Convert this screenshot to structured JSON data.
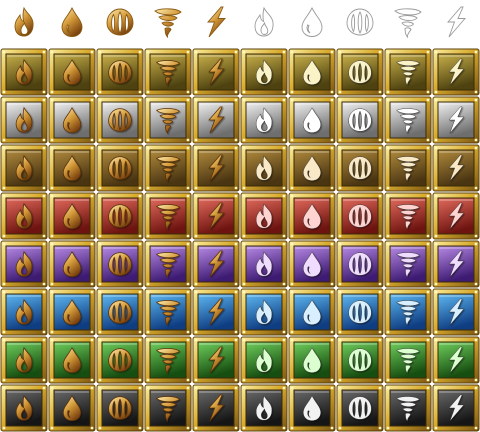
{
  "sprite_sheet": {
    "elements": [
      "fire",
      "water",
      "earth",
      "wind",
      "lightning"
    ],
    "header_styles": [
      "gold-outline",
      "white-outline"
    ],
    "tile_variants": [
      "gold-emblem",
      "white-emblem"
    ],
    "gold": {
      "frame_light": "#f7e27a",
      "frame_mid": "#d9ab2e",
      "frame_dark": "#7a5510",
      "emblem_light": "#fff0b5",
      "emblem_mid": "#d49a3a",
      "emblem_dark": "#6e3d0c"
    },
    "rows": [
      {
        "theme": "olive",
        "top": "#c9b04a",
        "bottom": "#4d4210",
        "white_tint": "#fbf3c8"
      },
      {
        "theme": "silver",
        "top": "#f2f2f2",
        "bottom": "#6e6e6e",
        "white_tint": "#ffffff"
      },
      {
        "theme": "brown",
        "top": "#b08a3c",
        "bottom": "#4a3512",
        "white_tint": "#fae9c6"
      },
      {
        "theme": "red",
        "top": "#e26a5c",
        "bottom": "#6e1410",
        "white_tint": "#ffd3cf"
      },
      {
        "theme": "purple",
        "top": "#b78ae6",
        "bottom": "#3e1b72",
        "white_tint": "#f0dcff"
      },
      {
        "theme": "blue",
        "top": "#5db8f2",
        "bottom": "#0f3d82",
        "white_tint": "#d8efff"
      },
      {
        "theme": "green",
        "top": "#6fcf5c",
        "bottom": "#164d10",
        "white_tint": "#dcffd0"
      },
      {
        "theme": "black",
        "top": "#6a6a6a",
        "bottom": "#151515",
        "white_tint": "#f2f2f2"
      }
    ]
  }
}
